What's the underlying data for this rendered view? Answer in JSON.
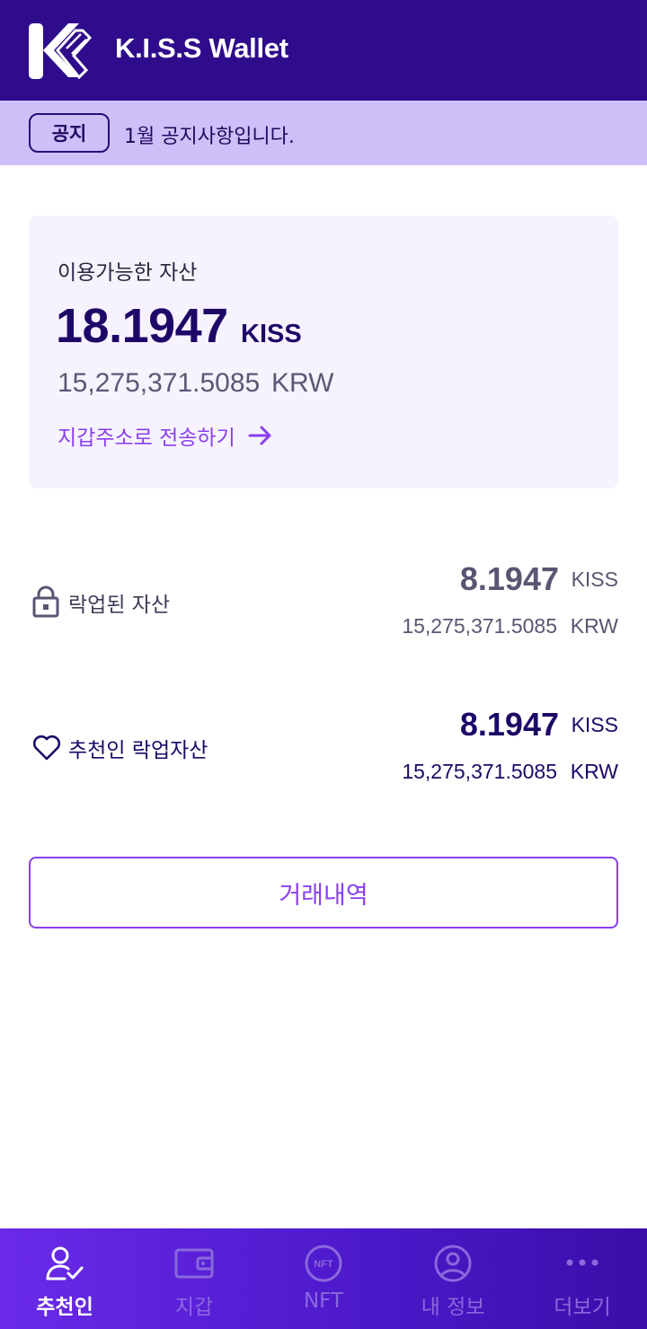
{
  "header": {
    "title": "K.I.S.S Wallet"
  },
  "notice": {
    "badge": "공지",
    "text": "1월 공지사항입니다."
  },
  "available": {
    "label": "이용가능한 자산",
    "amount": "18.1947",
    "unit": "KISS",
    "krw": "15,275,371.5085",
    "krw_unit": "KRW",
    "send_link": "지갑주소로 전송하기"
  },
  "locked": {
    "label": "락업된 자산",
    "amount": "8.1947",
    "unit": "KISS",
    "krw": "15,275,371.5085",
    "krw_unit": "KRW"
  },
  "referral_locked": {
    "label": "추천인 락업자산",
    "amount": "8.1947",
    "unit": "KISS",
    "krw": "15,275,371.5085",
    "krw_unit": "KRW"
  },
  "history_button": "거래내역",
  "nav": {
    "items": [
      {
        "label": "추천인",
        "icon": "user-check-icon",
        "active": true
      },
      {
        "label": "지갑",
        "icon": "wallet-icon",
        "active": false
      },
      {
        "label": "NFT",
        "icon": "nft-icon",
        "active": false
      },
      {
        "label": "내 정보",
        "icon": "profile-icon",
        "active": false
      },
      {
        "label": "더보기",
        "icon": "more-icon",
        "active": false
      }
    ]
  },
  "colors": {
    "header_bg": "#2e0c8c",
    "notice_bg": "#cdc0f8",
    "accent": "#8a3ef0",
    "primary_text": "#1d0868",
    "nav_active": "#ffffff",
    "nav_inactive": "#8a68dd"
  }
}
